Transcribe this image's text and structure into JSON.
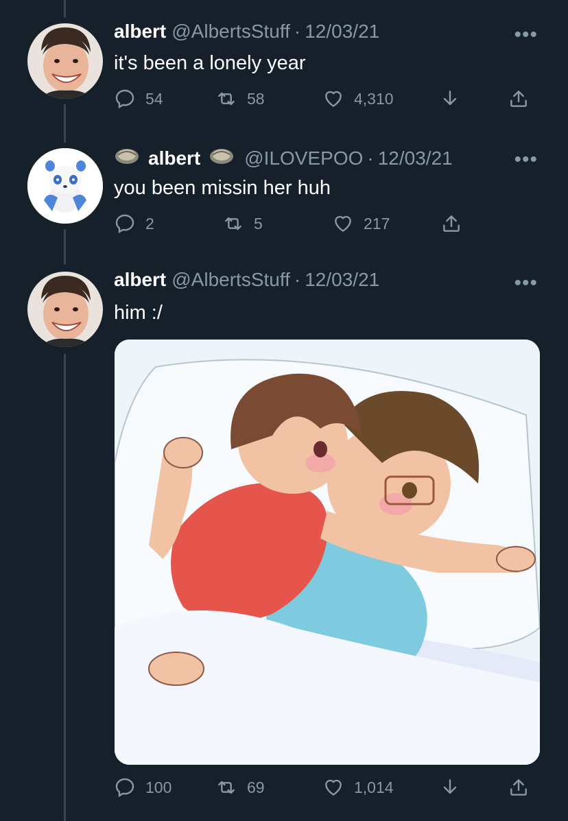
{
  "tweets": [
    {
      "name": "albert",
      "handle": "@AlbertsStuff",
      "date": "12/03/21",
      "text": "it's been a lonely year",
      "replies": "54",
      "retweets": "58",
      "likes": "4,310",
      "avatar": "smiling-man-avatar"
    },
    {
      "name": "albert",
      "handle": "@ILOVEPOO",
      "date": "12/03/21",
      "text": "you been missin her huh",
      "replies": "2",
      "retweets": "5",
      "likes": "217",
      "avatar": "blue-panda-avatar",
      "name_emoji": "oyster-icon"
    },
    {
      "name": "albert",
      "handle": "@AlbertsStuff",
      "date": "12/03/21",
      "text": "him :/",
      "replies": "100",
      "retweets": "69",
      "likes": "1,014",
      "avatar": "smiling-man-avatar",
      "media": "anime-couple-cuddling-illustration"
    }
  ],
  "separator": "·",
  "more_label": "•••",
  "colors": {
    "background": "#15202b",
    "secondary_text": "#8899a6",
    "thread_line": "#38444d"
  }
}
